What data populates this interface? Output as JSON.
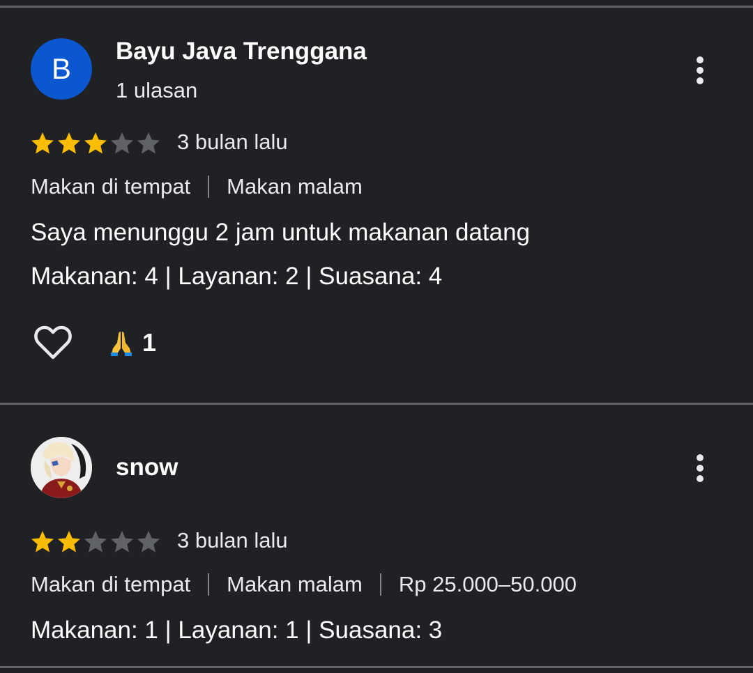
{
  "reviews": [
    {
      "author": "Bayu Java Trenggana",
      "avatar_letter": "B",
      "review_count": "1 ulasan",
      "rating": 3,
      "max_rating": 5,
      "time": "3 bulan lalu",
      "tags": [
        "Makan di tempat",
        "Makan malam"
      ],
      "text": "Saya menunggu 2 jam untuk makanan datang",
      "aspects": "Makanan: 4 | Layanan: 2 | Suasana: 4",
      "reaction_icon": "folded-hands-emoji",
      "reaction_count": "1"
    },
    {
      "author": "snow",
      "avatar": "profile-photo",
      "rating": 2,
      "max_rating": 5,
      "time": "3 bulan lalu",
      "tags": [
        "Makan di tempat",
        "Makan malam",
        "Rp 25.000–50.000"
      ],
      "aspects": "Makanan: 1 | Layanan: 1 | Suasana: 3"
    }
  ],
  "colors": {
    "background": "#202124",
    "star_filled": "#fbbc04",
    "star_empty": "#5f6368",
    "avatar_bg": "#0b57d0",
    "divider": "#5f6368"
  }
}
